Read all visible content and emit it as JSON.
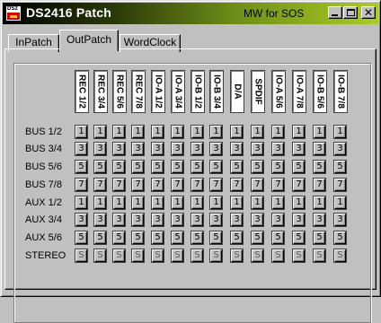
{
  "window": {
    "title": "DS2416 Patch",
    "subtitle": "MW for SOS",
    "app_icon_text": "DS2",
    "controls": [
      "minimize-button",
      "maximize-button",
      "close-button"
    ]
  },
  "tabs": [
    {
      "label": "InPatch",
      "active": false
    },
    {
      "label": "OutPatch",
      "active": true
    },
    {
      "label": "WordClock",
      "active": false
    }
  ],
  "columns": [
    "REC 1/2",
    "REC 3/4",
    "REC 5/6",
    "REC 7/8",
    "IO-A 1/2",
    "IO-A 3/4",
    "IO-B 1/2",
    "IO-B 3/4",
    "D/A",
    "SPDIF",
    "IO-A 5/6",
    "IO-A 7/8",
    "IO-B 5/6",
    "IO-B 7/8"
  ],
  "rows": [
    {
      "label": "BUS 1/2",
      "value": "1"
    },
    {
      "label": "BUS 3/4",
      "value": "3"
    },
    {
      "label": "BUS 5/6",
      "value": "5"
    },
    {
      "label": "BUS 7/8",
      "value": "7"
    },
    {
      "label": "AUX 1/2",
      "value": "1"
    },
    {
      "label": "AUX 3/4",
      "value": "3"
    },
    {
      "label": "AUX 5/6",
      "value": "5"
    },
    {
      "label": "STEREO",
      "value": "S"
    }
  ],
  "colors": {
    "face": "#c0c0c0",
    "title_gradient_start": "#000000",
    "title_gradient_end": "#a9cc24"
  }
}
